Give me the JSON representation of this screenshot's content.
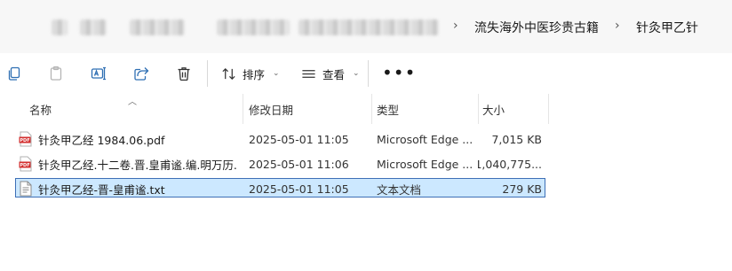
{
  "breadcrumb": {
    "separator": "›",
    "items": [
      "流失海外中医珍贵古籍",
      "针灸甲乙针"
    ]
  },
  "toolbar": {
    "sort_label": "排序",
    "view_label": "查看",
    "more_label": "•••"
  },
  "columns": {
    "name": "名称",
    "date": "修改日期",
    "type": "类型",
    "size": "大小"
  },
  "files": [
    {
      "icon": "pdf-file-icon",
      "name": "针灸甲乙经 1984.06.pdf",
      "date": "2025-05-01 11:05",
      "type": "Microsoft Edge ...",
      "size": "7,015 KB",
      "selected": false
    },
    {
      "icon": "pdf-file-icon",
      "name": "针灸甲乙经.十二卷.晋.皇甫谧.编.明万历...",
      "date": "2025-05-01 11:06",
      "type": "Microsoft Edge ...",
      "size": "1,040,775...",
      "selected": false
    },
    {
      "icon": "text-file-icon",
      "name": "针灸甲乙经-晋-皇甫谧.txt",
      "date": "2025-05-01 11:05",
      "type": "文本文档",
      "size": "279 KB",
      "selected": true
    }
  ],
  "colors": {
    "selection_bg": "#cce8ff",
    "selection_border": "#3d6fb6",
    "pdf_red": "#d32f2f",
    "accent_blue": "#2f6fb3"
  }
}
